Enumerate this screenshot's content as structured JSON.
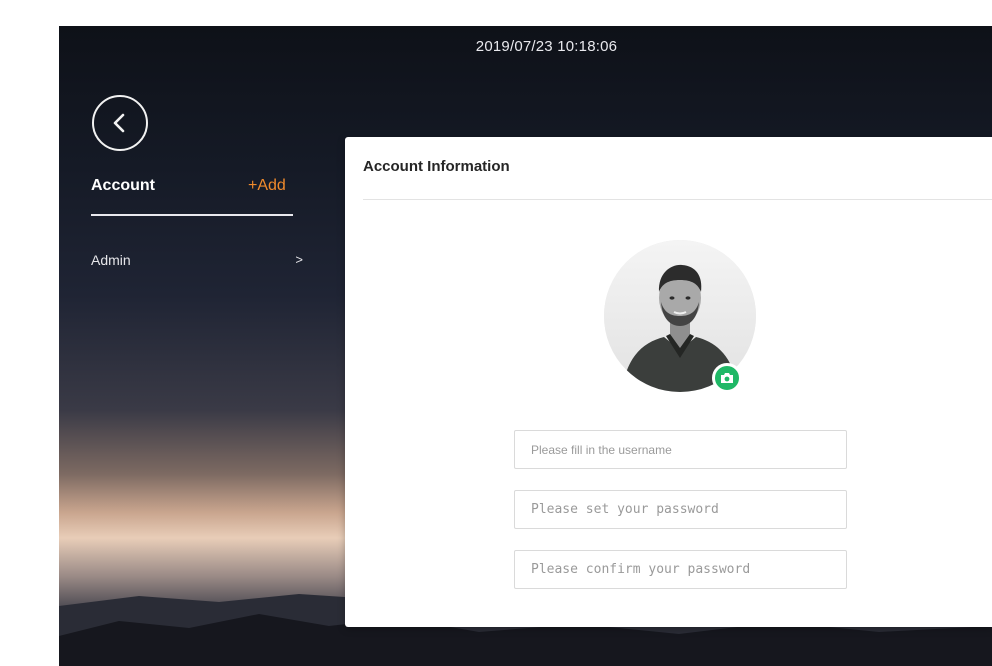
{
  "status_bar": {
    "datetime": "2019/07/23 10:18:06"
  },
  "sidebar": {
    "title": "Account",
    "add_label": "+Add",
    "items": [
      {
        "label": "Admin",
        "chevron": ">"
      }
    ]
  },
  "account_panel": {
    "title": "Account Information",
    "avatar_icon": "user-photo",
    "camera_icon": "camera-icon",
    "fields": {
      "username_placeholder": "Please fill in the username",
      "password_placeholder": "Please set your password",
      "confirm_placeholder": "Please confirm your password"
    }
  },
  "colors": {
    "accent_orange": "#f08a2c",
    "camera_green": "#1fb866"
  }
}
